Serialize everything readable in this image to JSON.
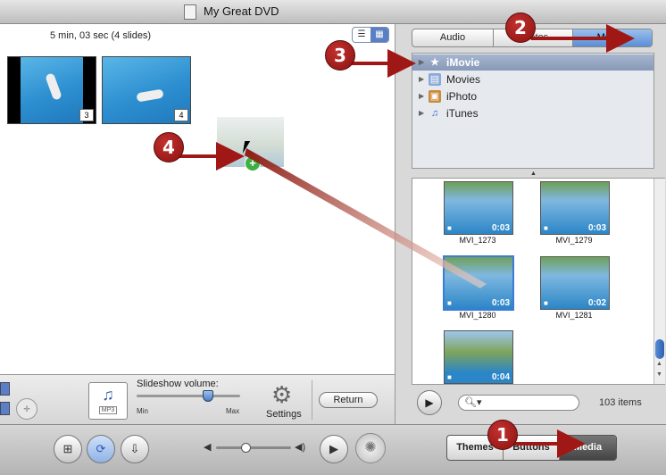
{
  "window": {
    "title": "My Great DVD"
  },
  "slideshow": {
    "duration": "5 min, 03 sec  (4 slides)",
    "slides": [
      {
        "number": "3"
      },
      {
        "number": "4"
      }
    ]
  },
  "controls": {
    "mp3_label": "MP3",
    "volume_label": "Slideshow volume:",
    "volume_min": "Min",
    "volume_max": "Max",
    "volume_level": 0.7,
    "settings_label": "Settings",
    "return_label": "Return"
  },
  "media_browser": {
    "segments": [
      "Audio",
      "Photos",
      "Movies"
    ],
    "selected_segment": "Movies",
    "sources": [
      {
        "name": "iMovie",
        "icon": "star-icon",
        "selected": true
      },
      {
        "name": "Movies",
        "icon": "folder-icon",
        "selected": false
      },
      {
        "name": "iPhoto",
        "icon": "iphoto-icon",
        "selected": false
      },
      {
        "name": "iTunes",
        "icon": "itunes-icon",
        "selected": false
      }
    ],
    "clips": [
      {
        "name": "MVI_1273",
        "duration": "0:03"
      },
      {
        "name": "MVI_1279",
        "duration": "0:03"
      },
      {
        "name": "MVI_1280",
        "duration": "0:03"
      },
      {
        "name": "MVI_1281",
        "duration": "0:02"
      },
      {
        "name": "",
        "duration": "0:04"
      }
    ],
    "item_count": "103 items"
  },
  "bottom_tabs": [
    "Themes",
    "Buttons",
    "Media"
  ],
  "selected_tab": "Media",
  "callouts": [
    "1",
    "2",
    "3",
    "4"
  ],
  "colors": {
    "accent": "#5a8ed6",
    "callout": "#a01816"
  }
}
